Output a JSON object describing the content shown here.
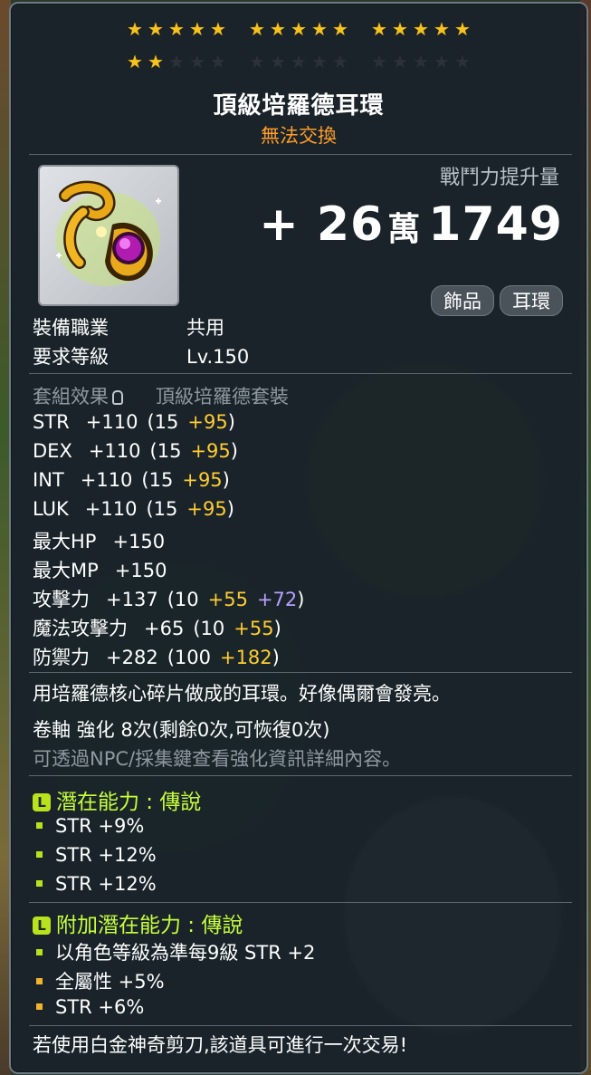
{
  "colors": {
    "star_on": "#f6c21e",
    "star_off": "#2c3138",
    "trade_note": "#ff9d2a",
    "bonus_yellow": "#ffcc33",
    "bonus_purple": "#b7a0ff",
    "potential_green": "#c8ff3c",
    "legendary_badge": "#b9e21e",
    "bonus_bullet": "#f2b42a"
  },
  "stars": {
    "filled": 17,
    "total": 30
  },
  "item": {
    "name": "頂級培羅德耳環",
    "trade_note": "無法交換",
    "icon": "purple-gem-gold-earring-icon"
  },
  "power": {
    "label": "戰鬥力提升量",
    "sign": "+",
    "main": "26",
    "unit": "萬",
    "rest": "1749"
  },
  "tags": [
    "飾品",
    "耳環"
  ],
  "requirements": [
    {
      "label": "裝備職業",
      "value": "共用"
    },
    {
      "label": "要求等級",
      "value": "Lv.150"
    }
  ],
  "set_effect": {
    "label": "套組效果",
    "value": "頂級培羅德套裝"
  },
  "stats": [
    {
      "name": "STR",
      "total": "+110",
      "open": "(15",
      "bonus": "+95",
      "bonus2": "",
      "close": ")"
    },
    {
      "name": "DEX",
      "total": "+110",
      "open": "(15",
      "bonus": "+95",
      "bonus2": "",
      "close": ")"
    },
    {
      "name": "INT",
      "total": "+110",
      "open": "(15",
      "bonus": "+95",
      "bonus2": "",
      "close": ")"
    },
    {
      "name": "LUK",
      "total": "+110",
      "open": "(15",
      "bonus": "+95",
      "bonus2": "",
      "close": ")"
    },
    {
      "name": "最大HP",
      "total": "+150",
      "open": "",
      "bonus": "",
      "bonus2": "",
      "close": ""
    },
    {
      "name": "最大MP",
      "total": "+150",
      "open": "",
      "bonus": "",
      "bonus2": "",
      "close": ""
    },
    {
      "name": "攻擊力",
      "total": "+137",
      "open": "(10",
      "bonus": "+55",
      "bonus2": "+72",
      "close": ")"
    },
    {
      "name": "魔法攻擊力",
      "total": "+65",
      "open": "(10",
      "bonus": "+55",
      "bonus2": "",
      "close": ")"
    },
    {
      "name": "防禦力",
      "total": "+282",
      "open": "(100",
      "bonus": "+182",
      "bonus2": "",
      "close": ")"
    }
  ],
  "description": "用培羅德核心碎片做成的耳環。好像偶爾會發亮。",
  "scroll_info": "卷軸 強化 8次(剩餘0次,可恢復0次)",
  "npc_hint": "可透過NPC/採集鍵查看強化資訊詳細內容。",
  "potential": {
    "header": "潛在能力 : 傳說",
    "badge": "L",
    "lines": [
      "STR +9%",
      "STR +12%",
      "STR +12%"
    ]
  },
  "bonus_potential": {
    "header": "附加潛在能力 : 傳說",
    "badge": "L",
    "lines": [
      "以角色等級為準每9級 STR +2",
      "全屬性 +5%",
      "STR +6%"
    ]
  },
  "footer": "若使用白金神奇剪刀,該道具可進行一次交易!"
}
